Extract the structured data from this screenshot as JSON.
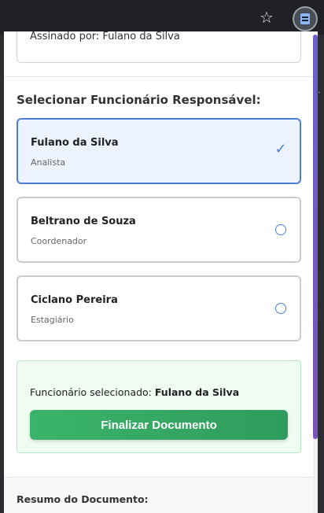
{
  "browser": {
    "star_icon": "★",
    "extension_icon": "doc-icon"
  },
  "popup": {
    "signed_by": "Assinado por: Fulano da Silva",
    "section_title": "Selecionar Funcionário Responsável:",
    "employees": [
      {
        "name": "Fulano da Silva",
        "role": "Analista",
        "selected": true
      },
      {
        "name": "Beltrano de Souza",
        "role": "Coordenador",
        "selected": false
      },
      {
        "name": "Ciclano Pereira",
        "role": "Estagiário",
        "selected": false
      }
    ],
    "selected_label": "Funcionário selecionado:",
    "selected_name": "Fulano da Silva",
    "finalize_button": "Finalizar Documento",
    "summary_title": "Resumo do Documento:"
  },
  "colors": {
    "accent_blue": "#4d7fd6",
    "success_green": "#3bb46a",
    "success_bg": "#effcf2"
  }
}
